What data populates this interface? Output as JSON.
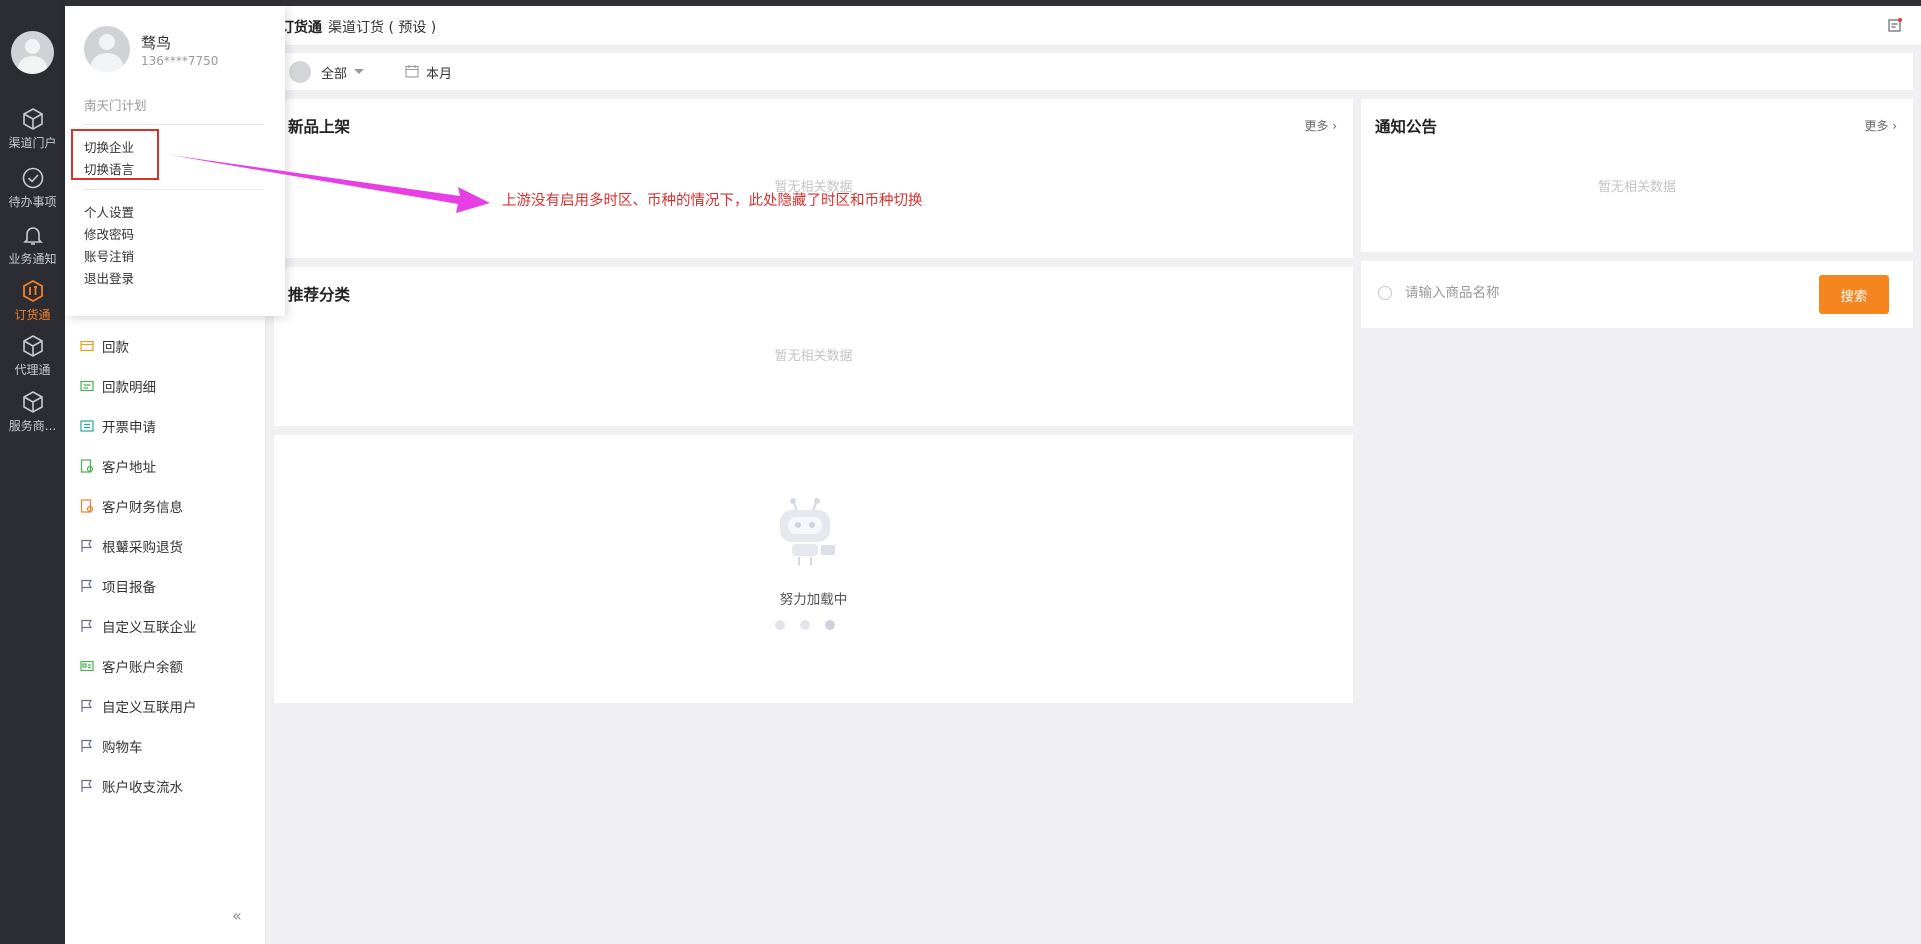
{
  "rail": {
    "items": [
      {
        "label": "渠道门户",
        "icon": "cube-icon"
      },
      {
        "label": "待办事项",
        "icon": "check-circle-icon"
      },
      {
        "label": "业务通知",
        "icon": "bell-icon"
      },
      {
        "label": "订货通",
        "icon": "order-hex-icon",
        "active": true
      },
      {
        "label": "代理通",
        "icon": "cube-icon"
      },
      {
        "label": "服务商...",
        "icon": "cube-icon"
      }
    ]
  },
  "menu": {
    "items": [
      {
        "label": "回款",
        "icon": "payment-icon"
      },
      {
        "label": "回款明细",
        "icon": "payment-detail-icon"
      },
      {
        "label": "开票申请",
        "icon": "invoice-icon"
      },
      {
        "label": "客户地址",
        "icon": "address-icon"
      },
      {
        "label": "客户财务信息",
        "icon": "finance-doc-icon"
      },
      {
        "label": "根鼙采购退货",
        "icon": "flag-icon"
      },
      {
        "label": "项目报备",
        "icon": "flag-icon"
      },
      {
        "label": "自定义互联企业",
        "icon": "flag-icon"
      },
      {
        "label": "客户账户余额",
        "icon": "account-card-icon"
      },
      {
        "label": "自定义互联用户",
        "icon": "flag-icon"
      },
      {
        "label": "购物车",
        "icon": "flag-icon"
      },
      {
        "label": "账户收支流水",
        "icon": "flag-icon"
      }
    ],
    "collapse": "«"
  },
  "popup": {
    "name": "骛鸟",
    "phone": "136****7750",
    "org": "南天门计划",
    "switch_company": "切换企业",
    "switch_language": "切换语言",
    "personal_settings": "个人设置",
    "change_password": "修改密码",
    "cancel_account": "账号注销",
    "logout": "退出登录"
  },
  "header": {
    "title": "订货通",
    "subtitle": "渠道订货 ( 预设 )"
  },
  "filter": {
    "scope": "全部",
    "period": "本月"
  },
  "panels": {
    "new_products": {
      "title": "新品上架",
      "more": "更多 ›",
      "empty": "暂无相关数据"
    },
    "notices": {
      "title": "通知公告",
      "more": "更多 ›",
      "empty": "暂无相关数据"
    },
    "recommend": {
      "title": "推荐分类",
      "empty": "暂无相关数据"
    },
    "loading": {
      "text": "努力加载中"
    }
  },
  "search": {
    "placeholder": "请输入商品名称",
    "button": "搜索"
  },
  "annotation": {
    "text": "上游没有启用多时区、币种的情况下，此处隐藏了时区和币种切换",
    "color": "#d9322e",
    "arrow_color": "#e83ee6"
  },
  "colors": {
    "accent": "#f5861f",
    "rail_bg": "#2b2d33",
    "page_bg": "#f0f0f2"
  }
}
